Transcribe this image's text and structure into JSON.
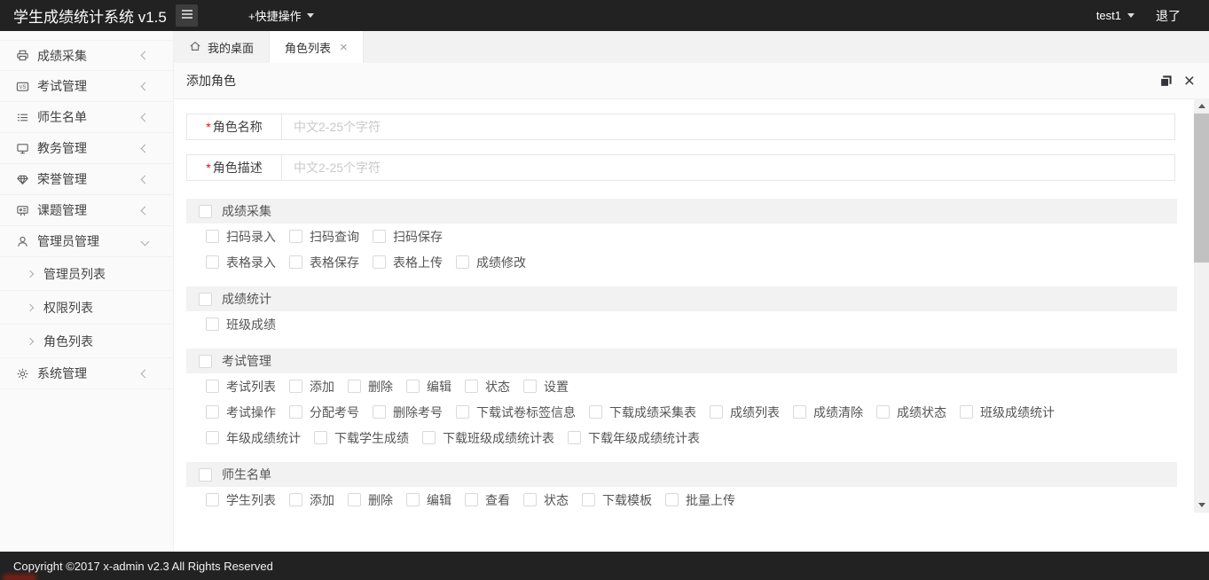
{
  "topbar": {
    "title": "学生成绩统计系统 v1.5",
    "quick_action_label": "+快捷操作",
    "username": "test1",
    "logout_label": "退了"
  },
  "sidebar": {
    "items": [
      {
        "key": "grade-collection",
        "icon": "printer-icon",
        "label": "成绩采集",
        "expanded": false
      },
      {
        "key": "exam-management",
        "icon": "vs-badge-icon",
        "label": "考试管理",
        "expanded": false
      },
      {
        "key": "teacher-student-list",
        "icon": "list-icon",
        "label": "师生名单",
        "expanded": false
      },
      {
        "key": "academic-affairs",
        "icon": "monitor-icon",
        "label": "教务管理",
        "expanded": false
      },
      {
        "key": "honor-management",
        "icon": "diamond-icon",
        "label": "荣誉管理",
        "expanded": false
      },
      {
        "key": "project-management",
        "icon": "presentation-board-icon",
        "label": "课题管理",
        "expanded": false
      },
      {
        "key": "admin-management",
        "icon": "user-icon",
        "label": "管理员管理",
        "expanded": true,
        "children": [
          {
            "key": "admin-list",
            "label": "管理员列表"
          },
          {
            "key": "permission-list",
            "label": "权限列表"
          },
          {
            "key": "role-list",
            "label": "角色列表"
          }
        ]
      },
      {
        "key": "system-management",
        "icon": "gear-icon",
        "label": "系统管理",
        "expanded": false
      }
    ]
  },
  "tabbar": {
    "tabs": [
      {
        "key": "my-desktop",
        "label": "我的桌面",
        "icon": "home-icon",
        "active": false,
        "closable": false
      },
      {
        "key": "role-list",
        "label": "角色列表",
        "active": true,
        "closable": true
      }
    ]
  },
  "panel": {
    "title": "添加角色"
  },
  "form": {
    "fields": [
      {
        "key": "role-name",
        "label": "角色名称",
        "required": true,
        "placeholder": "中文2-25个字符",
        "value": ""
      },
      {
        "key": "role-desc",
        "label": "角色描述",
        "required": true,
        "placeholder": "中文2-25个字符",
        "value": ""
      }
    ]
  },
  "permissions": {
    "groups": [
      {
        "key": "grade-collection",
        "name": "成绩采集",
        "checked": false,
        "rows": [
          [
            "扫码录入",
            "扫码查询",
            "扫码保存"
          ],
          [
            "表格录入",
            "表格保存",
            "表格上传",
            "成绩修改"
          ]
        ]
      },
      {
        "key": "grade-statistics",
        "name": "成绩统计",
        "checked": false,
        "rows": [
          [
            "班级成绩"
          ]
        ]
      },
      {
        "key": "exam-management",
        "name": "考试管理",
        "checked": false,
        "rows": [
          [
            "考试列表",
            "添加",
            "删除",
            "编辑",
            "状态",
            "设置"
          ],
          [
            "考试操作",
            "分配考号",
            "删除考号",
            "下载试卷标签信息",
            "下载成绩采集表",
            "成绩列表",
            "成绩清除",
            "成绩状态",
            "班级成绩统计"
          ],
          [
            "年级成绩统计",
            "下载学生成绩",
            "下载班级成绩统计表",
            "下载年级成绩统计表"
          ]
        ]
      },
      {
        "key": "teacher-student-list",
        "name": "师生名单",
        "checked": false,
        "rows": [
          [
            "学生列表",
            "添加",
            "删除",
            "编辑",
            "查看",
            "状态",
            "下载模板",
            "批量上传"
          ]
        ]
      }
    ]
  },
  "footer": {
    "copyright": "Copyright ©2017 x-admin v2.3 All Rights Reserved"
  },
  "colors": {
    "topbar_bg": "#222222",
    "footer_bg": "#222222",
    "tabbar_bg": "#f2f2f2",
    "group_header_bg": "#f2f2f2",
    "required_asterisk": "#ff0000",
    "sidebar_bg": "#fafafa"
  }
}
